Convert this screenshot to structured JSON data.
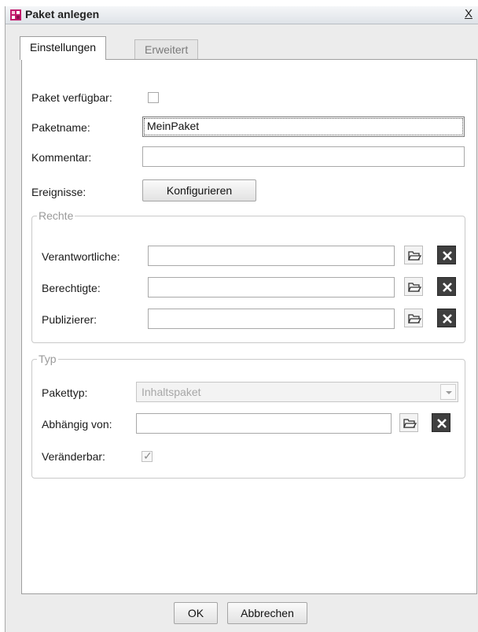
{
  "window": {
    "title": "Paket anlegen",
    "close_label": "X"
  },
  "tabs": [
    {
      "label": "Einstellungen"
    },
    {
      "label": "Erweitert"
    }
  ],
  "general": {
    "available_label": "Paket verfügbar:",
    "name_label": "Paketname:",
    "name_value": "MeinPaket",
    "comment_label": "Kommentar:",
    "comment_value": "",
    "events_label": "Ereignisse:",
    "configure_button": "Konfigurieren"
  },
  "rights": {
    "legend": "Rechte",
    "rows": [
      {
        "label": "Verantwortliche:",
        "value": ""
      },
      {
        "label": "Berechtigte:",
        "value": ""
      },
      {
        "label": "Publizierer:",
        "value": ""
      }
    ]
  },
  "type": {
    "legend": "Typ",
    "package_type_label": "Pakettyp:",
    "package_type_value": "Inhaltspaket",
    "depends_label": "Abhängig von:",
    "depends_value": "",
    "modifiable_label": "Veränderbar:",
    "modifiable_checked": true
  },
  "footer": {
    "ok": "OK",
    "cancel": "Abbrechen"
  },
  "colors": {
    "clear_button": "#3f3f3f",
    "app_icon": "#c2186b"
  }
}
